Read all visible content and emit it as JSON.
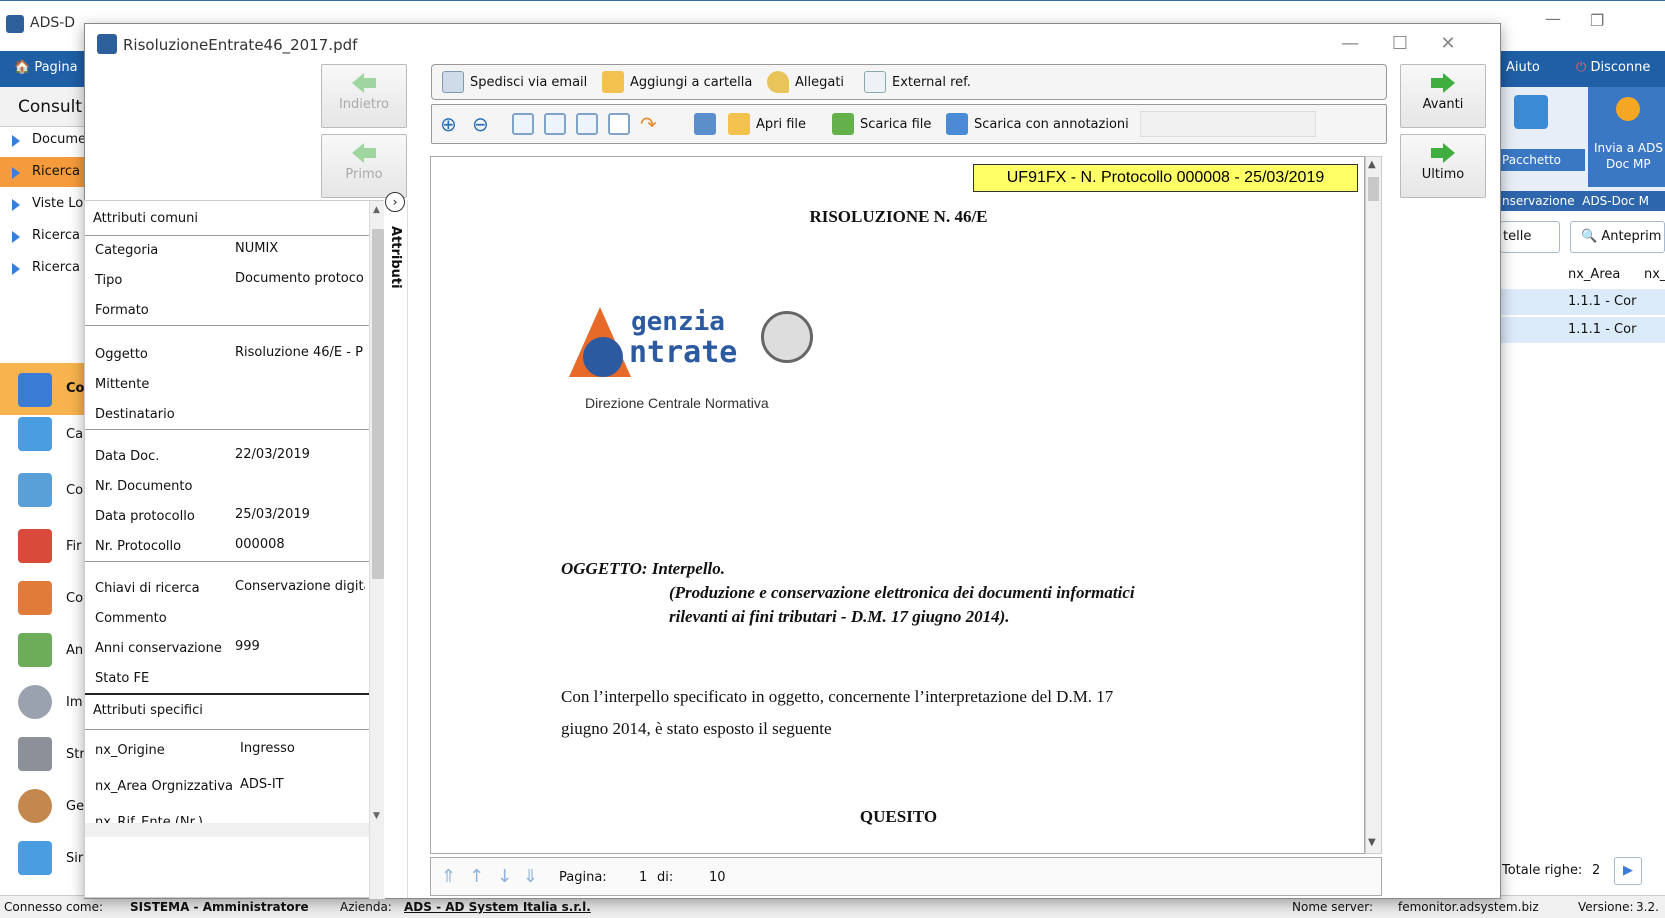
{
  "bg_app": {
    "title": "ADS-D",
    "menu": {
      "home_label": "Pagina",
      "help_label": "Aiuto",
      "disconnect_label": "Disconne"
    },
    "consult_label": "Consult",
    "nav_items": [
      "Docume",
      "Ricerca",
      "Viste Lo",
      "Ricerca",
      "Ricerca"
    ],
    "left_items": [
      "Co",
      "Ca",
      "Co",
      "Fir",
      "Co",
      "An",
      "Im",
      "Str",
      "Ge",
      "Sir"
    ],
    "ribbon": {
      "pacchetto": "Pacchetto",
      "invia_a": "Invia a ADS",
      "doc_mp": "Doc MP",
      "conservazione": "nservazione",
      "adsdoc": "ADS-Doc M"
    },
    "tabs": {
      "cartelle": "telle",
      "anteprima": "Anteprim"
    },
    "grid": {
      "header1": "nx_Area",
      "header2": "nx_",
      "rows": [
        "1.1.1 - Cor",
        "1.1.1 - Cor"
      ]
    },
    "totale_label": "Totale righe:",
    "totale_value": "2",
    "status": {
      "connesso_label": "Connesso come:",
      "user": "SISTEMA - Amministratore",
      "azienda_label": "Azienda:",
      "azienda": "ADS - AD System Italia s.r.l.",
      "server_label": "Nome server:",
      "server": "femonitor.adsystem.biz",
      "version_label": "Versione:",
      "version": "3.2."
    }
  },
  "dialog": {
    "title": "RisoluzioneEntrate46_2017.pdf",
    "nav": {
      "back": "Indietro",
      "first": "Primo",
      "forward": "Avanti",
      "last": "Ultimo"
    },
    "toolbar1": {
      "email": "Spedisci via email",
      "folder": "Aggiungi a cartella",
      "attach": "Allegati",
      "external": "External ref."
    },
    "toolbar2": {
      "open": "Apri file",
      "download": "Scarica file",
      "download_annot": "Scarica con annotazioni"
    },
    "side_tab": "Attributi",
    "attributes": {
      "common_header": "Attributi comuni",
      "rows": [
        {
          "k": "Categoria",
          "v": "NUMIX"
        },
        {
          "k": "Tipo",
          "v": "Documento protoco"
        },
        {
          "k": "Formato",
          "v": ""
        },
        {
          "k": "Oggetto",
          "v": "Risoluzione 46/E - P"
        },
        {
          "k": "Mittente",
          "v": ""
        },
        {
          "k": "Destinatario",
          "v": ""
        },
        {
          "k": "Data Doc.",
          "v": "22/03/2019"
        },
        {
          "k": "Nr. Documento",
          "v": ""
        },
        {
          "k": "Data protocollo",
          "v": "25/03/2019"
        },
        {
          "k": "Nr. Protocollo",
          "v": "000008"
        },
        {
          "k": "Chiavi di ricerca",
          "v": "Conservazione digita"
        },
        {
          "k": "Commento",
          "v": ""
        },
        {
          "k": "Anni conservazione",
          "v": "999"
        },
        {
          "k": "Stato FE",
          "v": ""
        }
      ],
      "specific_header": "Attributi specifici",
      "specific_rows": [
        {
          "k": "nx_Origine",
          "v": "Ingresso"
        },
        {
          "k": "nx_Area Orgnizzativa",
          "v": "ADS-IT"
        },
        {
          "k": "nx_Rif_Ente (Nr.)",
          "v": ""
        }
      ]
    },
    "document": {
      "stamp": "UF91FX - N. Protocollo 000008 - 25/03/2019",
      "heading": "RISOLUZIONE N. 46/E",
      "logo_top": "genzia",
      "logo_bottom": "ntrate",
      "direzione": "Direzione Centrale Normativa",
      "oggetto_label": "OGGETTO: Interpello.",
      "oggetto_line1": "(Produzione e conservazione elettronica dei documenti informatici",
      "oggetto_line2": "rilevanti ai fini tributari - D.M. 17 giugno 2014).",
      "body_line1": "Con l’interpello specificato in oggetto, concernente l’interpretazione del D.M. 17",
      "body_line2": "giugno 2014, è stato esposto il seguente",
      "quesito": "QUESITO"
    },
    "pager": {
      "label": "Pagina:",
      "current": "1",
      "of_label": "di:",
      "total": "10"
    }
  }
}
